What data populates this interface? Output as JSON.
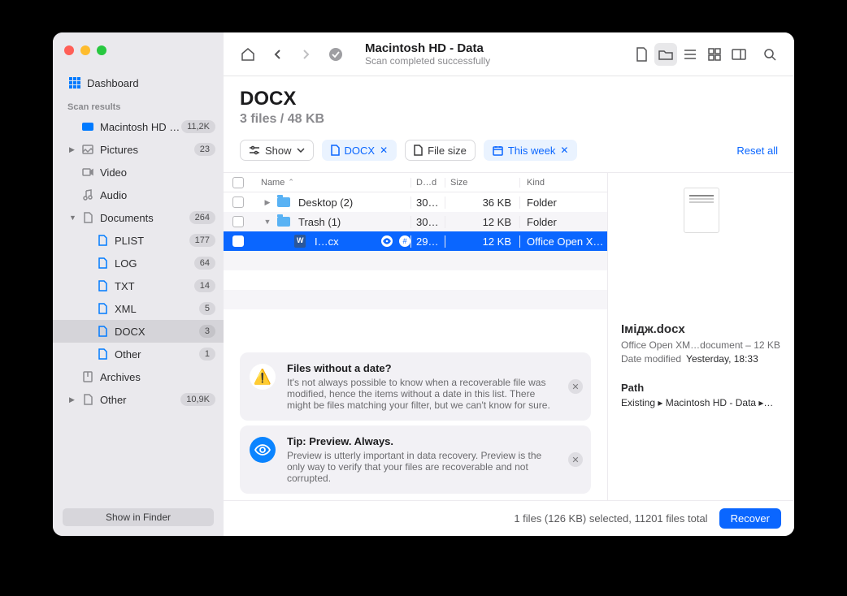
{
  "toolbar": {
    "title": "Macintosh HD - Data",
    "subtitle": "Scan completed successfully"
  },
  "sidebar": {
    "dashboard": "Dashboard",
    "results_heading": "Scan results",
    "items": [
      {
        "label": "Macintosh HD -…",
        "badge": "11,2K"
      },
      {
        "label": "Pictures",
        "badge": "23"
      },
      {
        "label": "Video"
      },
      {
        "label": "Audio"
      },
      {
        "label": "Documents",
        "badge": "264"
      },
      {
        "label": "PLIST",
        "badge": "177"
      },
      {
        "label": "LOG",
        "badge": "64"
      },
      {
        "label": "TXT",
        "badge": "14"
      },
      {
        "label": "XML",
        "badge": "5"
      },
      {
        "label": "DOCX",
        "badge": "3"
      },
      {
        "label": "Other",
        "badge": "1"
      },
      {
        "label": "Archives"
      },
      {
        "label": "Other",
        "badge": "10,9K"
      }
    ],
    "show_in_finder": "Show in Finder"
  },
  "header": {
    "title": "DOCX",
    "subtitle": "3 files / 48 KB"
  },
  "filters": {
    "show": "Show",
    "docx": "DOCX",
    "file_size": "File size",
    "this_week": "This week",
    "reset": "Reset all"
  },
  "columns": {
    "name": "Name",
    "date": "D…d",
    "size": "Size",
    "kind": "Kind"
  },
  "rows": [
    {
      "name": "Desktop (2)",
      "date": "30…",
      "size": "36 KB",
      "kind": "Folder"
    },
    {
      "name": "Trash (1)",
      "date": "30…",
      "size": "12 KB",
      "kind": "Folder"
    },
    {
      "name": "І…cx",
      "date": "29…",
      "size": "12 KB",
      "kind": "Office Open X…"
    }
  ],
  "tips": {
    "warn_title": "Files without a date?",
    "warn_body": "It's not always possible to know when a recoverable file was modified, hence the items without a date in this list. There might be files matching your filter, but we can't know for sure.",
    "prev_title": "Tip: Preview. Always.",
    "prev_body": "Preview is utterly important in data recovery. Preview is the only way to verify that your files are recoverable and not corrupted."
  },
  "preview": {
    "name": "Імідж.docx",
    "kind": "Office Open XM…document – 12 KB",
    "date_label": "Date modified",
    "date_value": "Yesterday, 18:33",
    "path_label": "Path",
    "path_value": "Existing ▸ Macintosh HD - Data ▸…"
  },
  "footer": {
    "status": "1 files (126 KB) selected, 11201 files total",
    "recover": "Recover"
  }
}
